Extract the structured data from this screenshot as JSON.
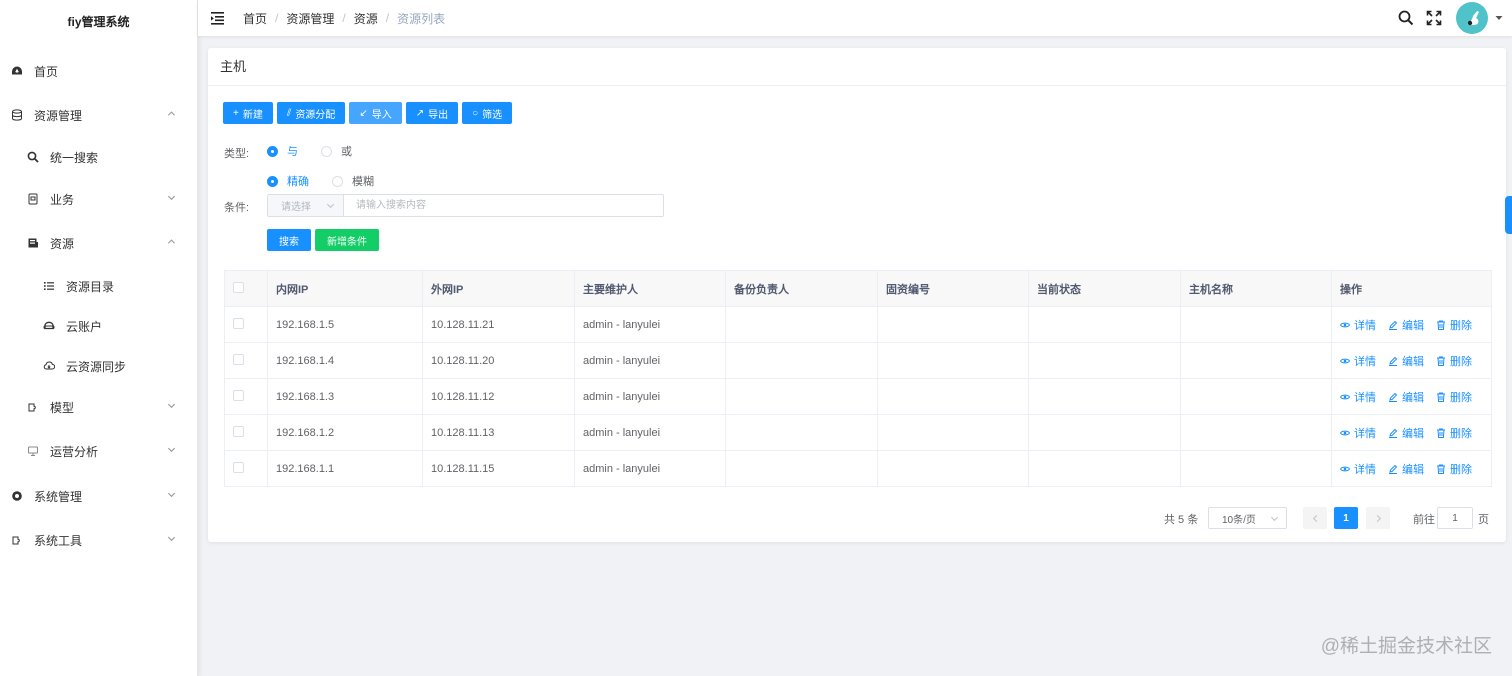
{
  "app": {
    "title": "fiy管理系统"
  },
  "sidebar": {
    "items": [
      {
        "label": "首页",
        "icon": "dashboard-icon"
      },
      {
        "label": "资源管理",
        "icon": "database-icon"
      },
      {
        "label": "统一搜索",
        "icon": "search-icon"
      },
      {
        "label": "业务",
        "icon": "business-icon"
      },
      {
        "label": "资源",
        "icon": "resource-icon"
      },
      {
        "label": "资源目录",
        "icon": "list-icon"
      },
      {
        "label": "云账户",
        "icon": "cloud-account-icon"
      },
      {
        "label": "云资源同步",
        "icon": "cloud-sync-icon"
      },
      {
        "label": "模型",
        "icon": "model-icon"
      },
      {
        "label": "运营分析",
        "icon": "monitor-icon"
      },
      {
        "label": "系统管理",
        "icon": "settings-icon"
      },
      {
        "label": "系统工具",
        "icon": "tools-icon"
      }
    ]
  },
  "breadcrumb": [
    "首页",
    "资源管理",
    "资源",
    "资源列表"
  ],
  "card": {
    "title": "主机"
  },
  "toolbar": {
    "new": "新建",
    "assign": "资源分配",
    "import": "导入",
    "export": "导出",
    "filter": "筛选"
  },
  "filter": {
    "type_label": "类型:",
    "logic_and": "与",
    "logic_or": "或",
    "match_exact": "精确",
    "match_fuzzy": "模糊",
    "cond_label": "条件:",
    "select_placeholder": "请选择",
    "input_placeholder": "请输入搜索内容",
    "search_btn": "搜索",
    "add_cond_btn": "新增条件"
  },
  "table": {
    "headers": [
      "内网IP",
      "外网IP",
      "主要维护人",
      "备份负责人",
      "固资编号",
      "当前状态",
      "主机名称",
      "操作"
    ],
    "rows": [
      {
        "inner_ip": "192.168.1.5",
        "outer_ip": "10.128.11.21",
        "maintainer": "admin - lanyulei",
        "backup": "",
        "asset": "",
        "status": "",
        "hostname": ""
      },
      {
        "inner_ip": "192.168.1.4",
        "outer_ip": "10.128.11.20",
        "maintainer": "admin - lanyulei",
        "backup": "",
        "asset": "",
        "status": "",
        "hostname": ""
      },
      {
        "inner_ip": "192.168.1.3",
        "outer_ip": "10.128.11.12",
        "maintainer": "admin - lanyulei",
        "backup": "",
        "asset": "",
        "status": "",
        "hostname": ""
      },
      {
        "inner_ip": "192.168.1.2",
        "outer_ip": "10.128.11.13",
        "maintainer": "admin - lanyulei",
        "backup": "",
        "asset": "",
        "status": "",
        "hostname": ""
      },
      {
        "inner_ip": "192.168.1.1",
        "outer_ip": "10.128.11.15",
        "maintainer": "admin - lanyulei",
        "backup": "",
        "asset": "",
        "status": "",
        "hostname": ""
      }
    ],
    "ops": {
      "detail": "详情",
      "edit": "编辑",
      "delete": "删除"
    }
  },
  "pagination": {
    "total": "共 5 条",
    "page_size": "10条/页",
    "current": "1",
    "goto_label": "前往",
    "goto_value": "1",
    "page_suffix": "页"
  },
  "watermark": "@稀土掘金技术社区",
  "colors": {
    "primary": "#1890ff",
    "success": "#13ce66",
    "avatar": "#4fc3c9"
  }
}
